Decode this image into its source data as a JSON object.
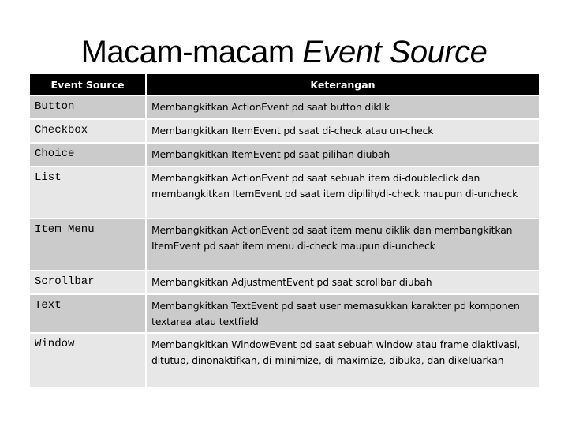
{
  "slide": {
    "title_plain": "Macam-macam ",
    "title_italic": "Event Source"
  },
  "table": {
    "headers": {
      "source": "Event Source",
      "description": "Keterangan"
    },
    "rows": [
      {
        "source": "Button",
        "description": "Membangkitkan ActionEvent pd saat button diklik"
      },
      {
        "source": "Checkbox",
        "description": "Membangkitkan ItemEvent pd saat di-check atau un-check"
      },
      {
        "source": "Choice",
        "description": "Membangkitkan ItemEvent pd saat pilihan diubah"
      },
      {
        "source": "List",
        "description": "Membangkitkan ActionEvent pd saat sebuah item di-doubleclick dan membangkitkan ItemEvent pd saat item dipilih/di-check maupun di-uncheck"
      },
      {
        "source": "Item Menu",
        "description": "Membangkitkan ActionEvent pd saat item menu diklik dan membangkitkan ItemEvent pd saat item menu di-check maupun di-uncheck"
      },
      {
        "source": "Scrollbar",
        "description": "Membangkitkan AdjustmentEvent pd saat scrollbar diubah"
      },
      {
        "source": "Text",
        "description": "Membangkitkan TextEvent pd saat user memasukkan karakter pd komponen textarea atau textfield"
      },
      {
        "source": "Window",
        "description": "Membangkitkan WindowEvent pd saat sebuah window atau frame diaktivasi, ditutup, dinonaktifkan, di-minimize, di-maximize, dibuka, dan dikeluarkan"
      }
    ]
  },
  "colors": {
    "header_bg": "#000000",
    "header_text": "#ffffff",
    "row_dark": "#cbcbcb",
    "row_light": "#e7e7e7"
  }
}
